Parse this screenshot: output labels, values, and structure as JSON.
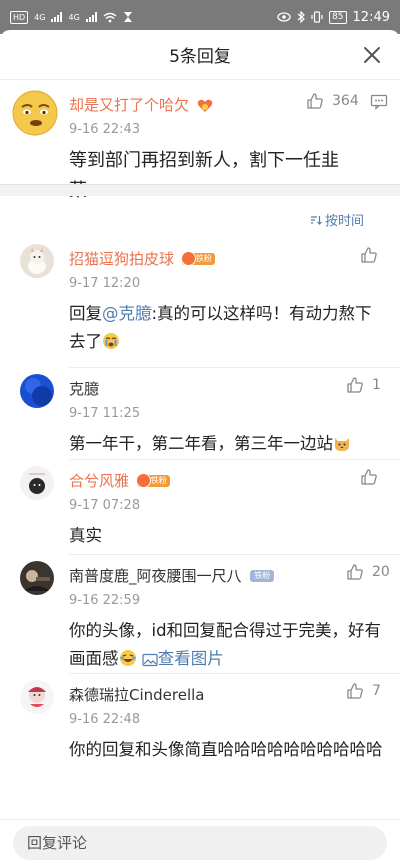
{
  "status_bar": {
    "left_chips": [
      "HD",
      "HD"
    ],
    "net1": "4G",
    "net2": "4G",
    "battery": "85",
    "time": "12:49"
  },
  "sheet": {
    "title": "5条回复",
    "close_icon": "close-icon"
  },
  "main_comment": {
    "username": "却是又打了个哈欠",
    "time": "9-16 22:43",
    "text": "等到部门再招到新人，割下一任韭菜……",
    "likes": "364",
    "username_color": "#eb7350"
  },
  "sort": {
    "label": "按时间"
  },
  "replies": [
    {
      "username": "招猫逗狗拍皮球",
      "badge": "铁粉",
      "time": "9-17 12:20",
      "text_prefix": "回复",
      "mention": "@克臆",
      "text": ":真的可以这样吗！有动力熬下去了",
      "likes": ""
    },
    {
      "username": "克臆",
      "badge": "",
      "time": "9-17 11:25",
      "text": "第一年干，第二年看，第三年一边站",
      "likes": "1"
    },
    {
      "username": "合兮风雅",
      "badge": "铁粉",
      "time": "9-17 07:28",
      "text": "真实",
      "likes": ""
    },
    {
      "username": "南普度鹿_阿夜腰围一尺八",
      "badge": "铁粉",
      "time": "9-16 22:59",
      "text": "你的头像，id和回复配合得过于完美，好有画面感",
      "view_image": "查看图片",
      "likes": "20"
    },
    {
      "username": "森德瑞拉Cinderella",
      "badge": "",
      "time": "9-16 22:48",
      "text": "你的回复和头像简直哈哈哈哈哈哈哈哈哈哈",
      "likes": "7"
    }
  ],
  "input": {
    "placeholder": "回复评论"
  },
  "colors": {
    "accent_link": "#507daf",
    "username_orange": "#eb7350",
    "muted": "#999999"
  }
}
